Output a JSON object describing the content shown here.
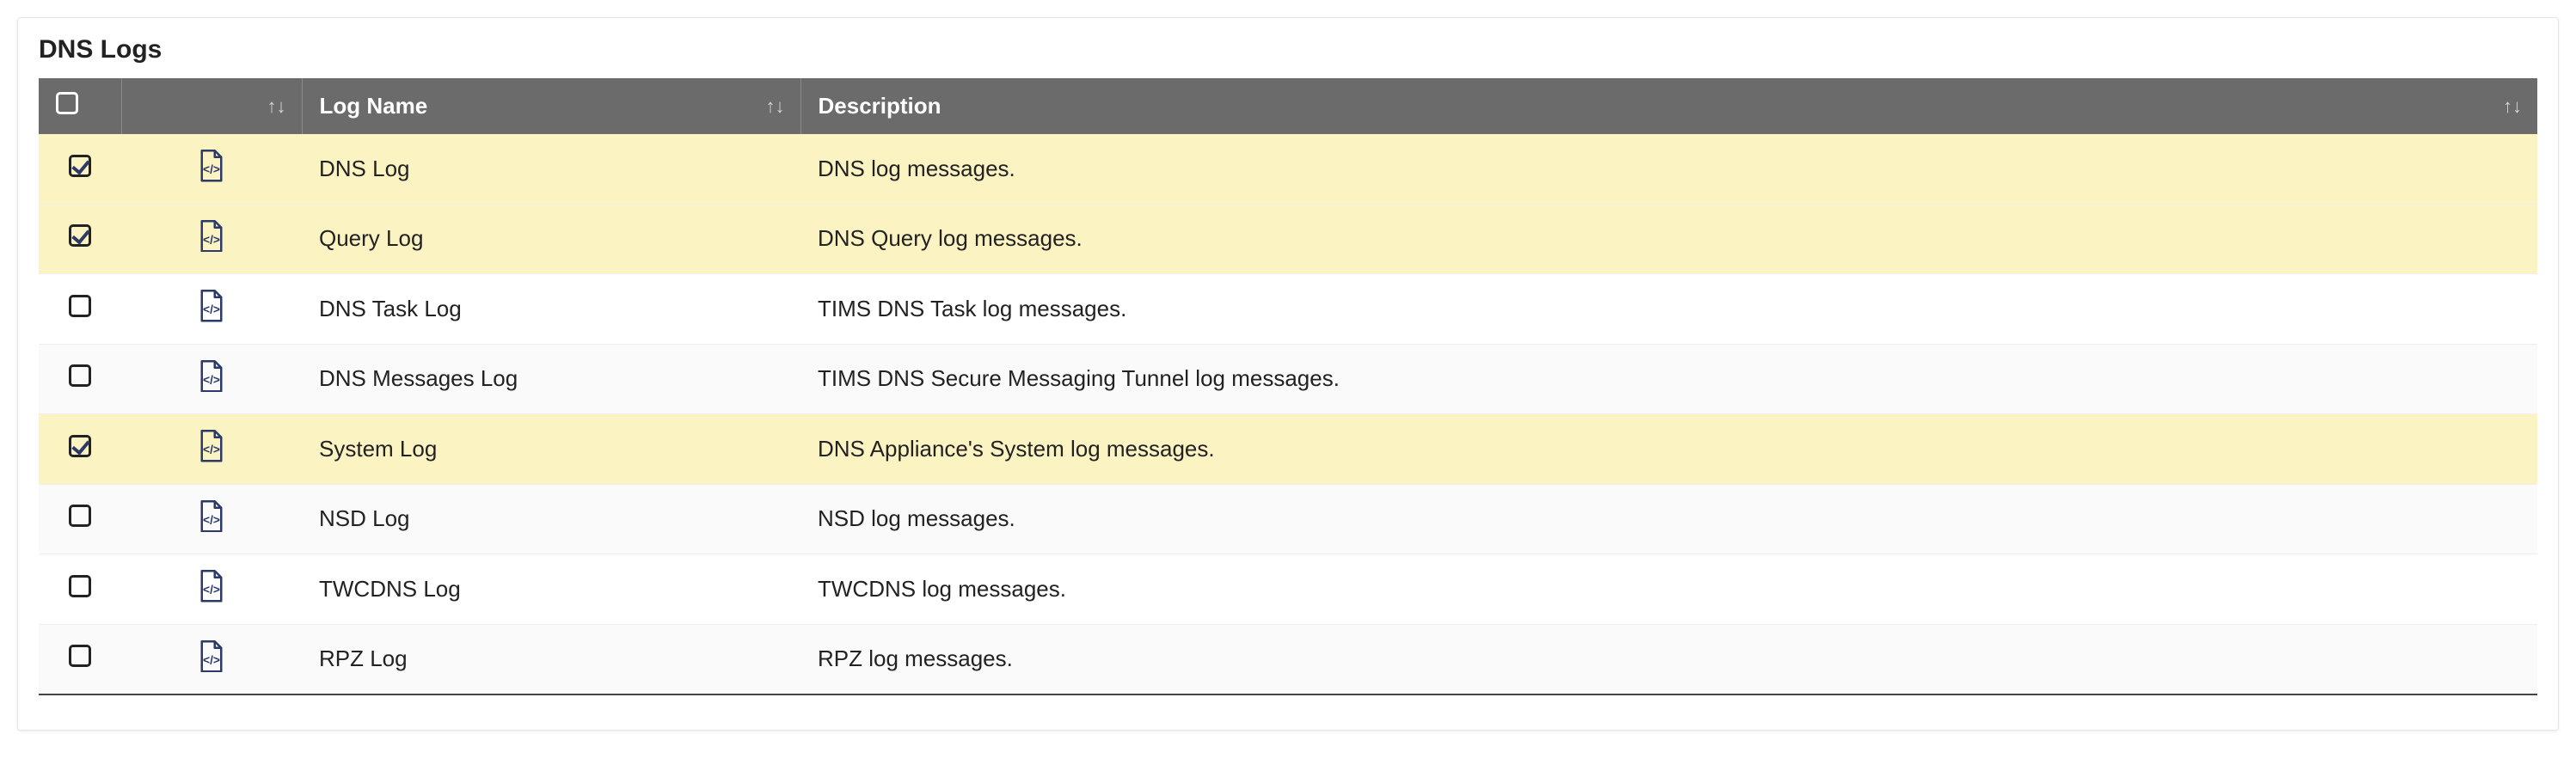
{
  "title": "DNS Logs",
  "columns": {
    "logname": "Log Name",
    "description": "Description"
  },
  "rows": [
    {
      "checked": true,
      "name": "DNS Log",
      "description": "DNS log messages."
    },
    {
      "checked": true,
      "name": "Query Log",
      "description": "DNS Query log messages."
    },
    {
      "checked": false,
      "name": "DNS Task Log",
      "description": "TIMS DNS Task log messages."
    },
    {
      "checked": false,
      "name": "DNS Messages Log",
      "description": "TIMS DNS Secure Messaging Tunnel log messages."
    },
    {
      "checked": true,
      "name": "System Log",
      "description": "DNS Appliance's System log messages."
    },
    {
      "checked": false,
      "name": "NSD Log",
      "description": "NSD log messages."
    },
    {
      "checked": false,
      "name": "TWCDNS Log",
      "description": "TWCDNS log messages."
    },
    {
      "checked": false,
      "name": "RPZ Log",
      "description": "RPZ log messages."
    }
  ]
}
